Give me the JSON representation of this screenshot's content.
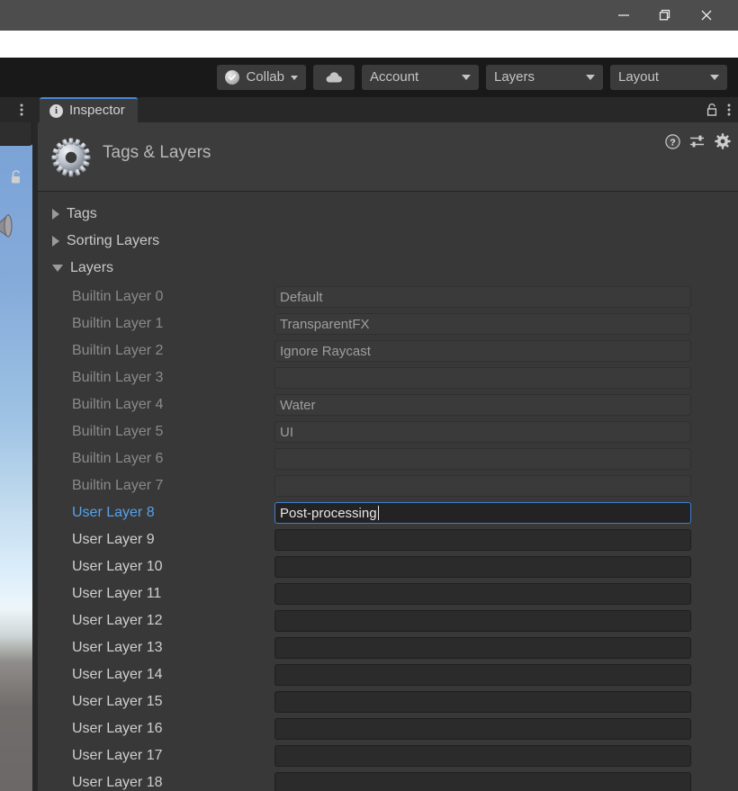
{
  "window": {
    "controls": [
      {
        "name": "minimize",
        "glyph": "minimize-icon"
      },
      {
        "name": "restore",
        "glyph": "restore-icon"
      },
      {
        "name": "close",
        "glyph": "close-icon"
      }
    ]
  },
  "toolbar": {
    "collab_label": "Collab",
    "cloud_label": "",
    "account_label": "Account",
    "layers_label": "Layers",
    "layout_label": "Layout"
  },
  "tabbar": {
    "tab_label": "Inspector",
    "lock_icon": "lock-icon",
    "kebab_icon": "kebab-menu-icon",
    "dock_kebab_icon": "kebab-menu-icon"
  },
  "inspector": {
    "title": "Tags & Layers",
    "icon": "gear-icon",
    "header_icons": [
      "help-icon",
      "preset-icon",
      "settings-gear-icon"
    ]
  },
  "sections": [
    {
      "label": "Tags",
      "expanded": false
    },
    {
      "label": "Sorting Layers",
      "expanded": false
    },
    {
      "label": "Layers",
      "expanded": true
    }
  ],
  "layers": [
    {
      "label": "Builtin Layer 0",
      "value": "Default",
      "builtin": true,
      "active": false
    },
    {
      "label": "Builtin Layer 1",
      "value": "TransparentFX",
      "builtin": true,
      "active": false
    },
    {
      "label": "Builtin Layer 2",
      "value": "Ignore Raycast",
      "builtin": true,
      "active": false
    },
    {
      "label": "Builtin Layer 3",
      "value": "",
      "builtin": true,
      "active": false
    },
    {
      "label": "Builtin Layer 4",
      "value": "Water",
      "builtin": true,
      "active": false
    },
    {
      "label": "Builtin Layer 5",
      "value": "UI",
      "builtin": true,
      "active": false
    },
    {
      "label": "Builtin Layer 6",
      "value": "",
      "builtin": true,
      "active": false
    },
    {
      "label": "Builtin Layer 7",
      "value": "",
      "builtin": true,
      "active": false
    },
    {
      "label": "User Layer 8",
      "value": "Post-processing",
      "builtin": false,
      "active": true
    },
    {
      "label": "User Layer 9",
      "value": "",
      "builtin": false,
      "active": false
    },
    {
      "label": "User Layer 10",
      "value": "",
      "builtin": false,
      "active": false
    },
    {
      "label": "User Layer 11",
      "value": "",
      "builtin": false,
      "active": false
    },
    {
      "label": "User Layer 12",
      "value": "",
      "builtin": false,
      "active": false
    },
    {
      "label": "User Layer 13",
      "value": "",
      "builtin": false,
      "active": false
    },
    {
      "label": "User Layer 14",
      "value": "",
      "builtin": false,
      "active": false
    },
    {
      "label": "User Layer 15",
      "value": "",
      "builtin": false,
      "active": false
    },
    {
      "label": "User Layer 16",
      "value": "",
      "builtin": false,
      "active": false
    },
    {
      "label": "User Layer 17",
      "value": "",
      "builtin": false,
      "active": false
    },
    {
      "label": "User Layer 18",
      "value": "",
      "builtin": false,
      "active": false
    }
  ],
  "scene_sliver": {
    "lock_icon": "lock-open-icon",
    "gizmo_icon": "audio-source-gizmo-icon"
  },
  "colors": {
    "accent_blue": "#4a87d1",
    "active_label": "#57a2e8",
    "focus_border": "#3f7fcf",
    "panel_bg": "#383838",
    "toolbar_bg": "#191919",
    "titlebar_bg": "#4d4d4d"
  }
}
